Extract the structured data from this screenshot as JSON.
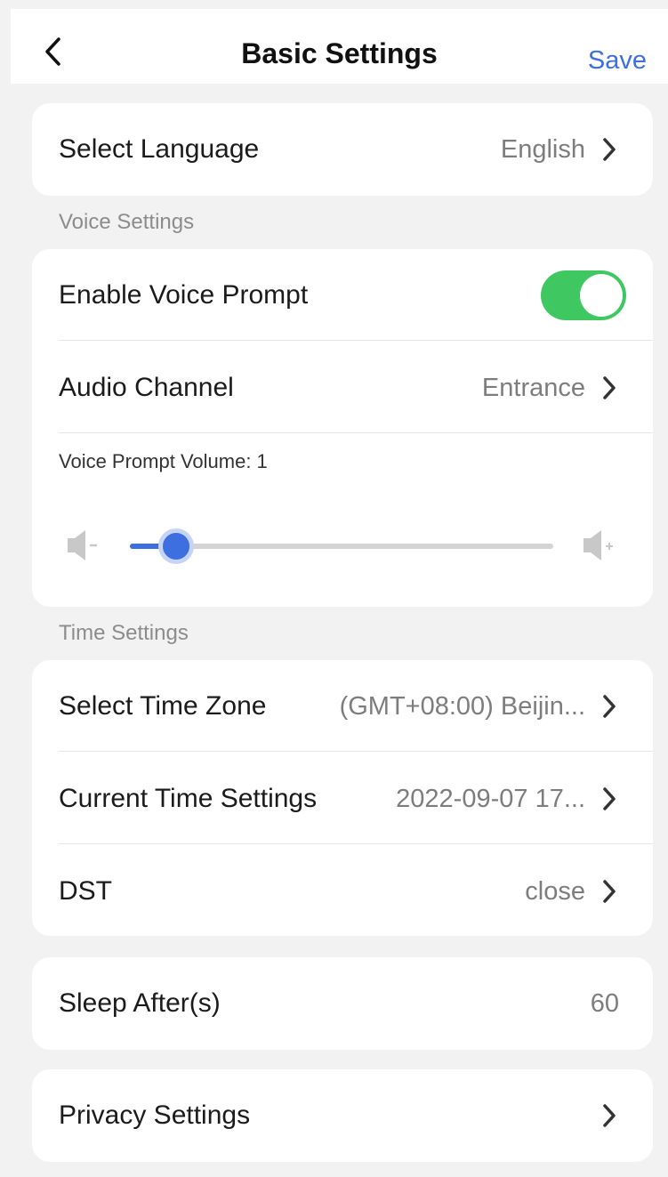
{
  "header": {
    "back_icon": "chevron-left-icon",
    "title": "Basic Settings",
    "save_label": "Save"
  },
  "language": {
    "label": "Select Language",
    "value": "English"
  },
  "voice_section": {
    "title": "Voice Settings",
    "enable_voice_prompt": {
      "label": "Enable Voice Prompt",
      "on": true,
      "on_color": "#3fc861"
    },
    "audio_channel": {
      "label": "Audio Channel",
      "value": "Entrance"
    },
    "volume": {
      "label": "Voice Prompt Volume: 1",
      "value": 1,
      "fraction": 0.11,
      "decrease_icon": "speaker-minus-icon",
      "increase_icon": "speaker-plus-icon",
      "accent_color": "#3d6fe0"
    }
  },
  "time_section": {
    "title": "Time Settings",
    "time_zone": {
      "label": "Select Time Zone",
      "value": "(GMT+08:00) Beijin..."
    },
    "current_time": {
      "label": "Current Time Settings",
      "value": "2022-09-07 17..."
    },
    "dst": {
      "label": "DST",
      "value": "close"
    }
  },
  "sleep": {
    "label": "Sleep After(s)",
    "value": "60"
  },
  "privacy": {
    "label": "Privacy Settings"
  }
}
